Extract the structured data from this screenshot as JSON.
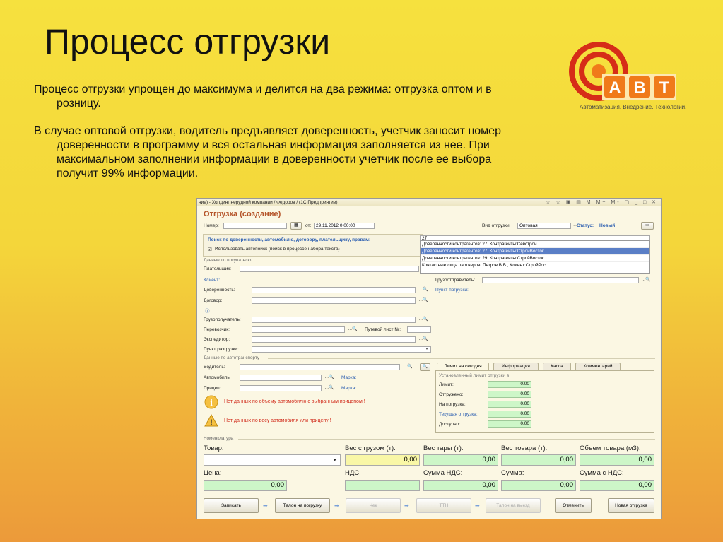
{
  "slide": {
    "title": "Процесс отгрузки",
    "p1_line1": "Процесс отгрузки упрощен до максимума и делится на два режима: отгрузка оптом и в",
    "p1_line2": "розницу.",
    "p2_line1": "В случае оптовой отгрузки, водитель предъявляет доверенность, учетчик заносит номер",
    "p2_line2": "доверенности в программу и вся остальная информация заполняется из нее. При",
    "p2_line3": "максимальном заполнении информации в доверенности учетчик после ее выбора",
    "p2_line4": "получит 99% информации."
  },
  "logo": {
    "text": "АВТ",
    "tagline": "Автоматизация. Внедрение. Технологии.",
    "accent": "#e5431d",
    "ring": "#d62d18",
    "orange": "#f07a1a"
  },
  "window": {
    "title": "ние) - Холдинг нерудной компании / Федоров / (1С:Предприятие)",
    "controls": "☆ ☆ ▣ ▤ M M+ M- ▢ _ □ ✕",
    "form_title": "Отгрузка (создание)",
    "nomer_label": "Номер:",
    "ot_label": "от:",
    "date_value": "29.11.2012  0:00:00",
    "vid_label": "Вид отгрузки:",
    "vid_value": "Оптовая",
    "status_label": "Статус:",
    "status_value": "Новый",
    "search_label": "Поиск по доверенности, автомобилю, договору, плательщику, правам:",
    "search_value": "27",
    "autosearch_label": "Использовать автопоиск (поиск в процессе набора текста)",
    "dropdown": [
      "Доверенности контрагентов: 27, Контрагенты:Севстрой",
      "Доверенности контрагентов: 27, Контрагенты:СтройВосток",
      "Доверенности контрагентов: 29, Контрагенты:СтройВосток",
      "Контактные лица партнеров: Петров В.В., Клиент:СтройРос"
    ],
    "sec_buyer": "Данные по покупателю",
    "platelschik": "Плательщик:",
    "klient": "Клиент:",
    "gruzootpravitel": "Грузоотправитель:",
    "doverennost": "Доверенность:",
    "punkt_pogruzki": "Пункт погрузки:",
    "dogovor": "Договор:",
    "gruzopoluchatel": "Грузополучатель:",
    "perevozchik": "Перевозчик:",
    "putevoy": "Путевой лист №:",
    "ekspeditor": "Экспедитор:",
    "punkt_razgruzki": "Пункт разгрузки:",
    "sec_auto": "Данные по автотранспорту",
    "voditel": "Водитель:",
    "avtomobil": "Автомобиль:",
    "marka1": "Марка:",
    "pricep": "Прицеп:",
    "marka2": "Марка:",
    "warn1": "Нет данных по объему автомобилю с выбранным прицепом !",
    "warn2": "Нет данных по весу автомобиля или прицепу !",
    "tabs": [
      "Лимит на сегодня",
      "Информация",
      "Касса",
      "Комментарий"
    ],
    "limit_header": "Установленный лимит отгрузки в",
    "limit_rows": [
      {
        "label": "Лимит:",
        "value": "0.00"
      },
      {
        "label": "Отгружено:",
        "value": "0.00"
      },
      {
        "label": "На погрузке:",
        "value": "0.00"
      },
      {
        "label": "Текущая отгрузка:",
        "value": "0.00"
      },
      {
        "label": "Доступно:",
        "value": "0.00"
      }
    ],
    "sec_nomen": "Номенклатура",
    "tovar": "Товар:",
    "ves_gruz": "Вес с грузом (т):",
    "ves_gruz_val": "0,00",
    "ves_tary": "Вес тары (т):",
    "ves_tary_val": "0,00",
    "ves_tovara": "Вес товара (т):",
    "ves_tovara_val": "0,00",
    "obem": "Объем товара (м3):",
    "obem_val": "0,00",
    "cena": "Цена:",
    "cena_val": "0,00",
    "nds": "НДС:",
    "summa_nds": "Сумма НДС:",
    "summa_nds_val": "0,00",
    "summa": "Сумма:",
    "summa_val": "0,00",
    "summa_s_nds": "Сумма с НДС:",
    "summa_s_nds_val": "0,00",
    "buttons": {
      "zapisat": "Записать",
      "talon_pogruzka": "Талон на погрузку",
      "chek": "Чек",
      "ttn": "ТТН",
      "talon_vyezd": "Талон на выезд",
      "otmenit": "Отменить",
      "novaya": "Новая отгрузка"
    }
  }
}
